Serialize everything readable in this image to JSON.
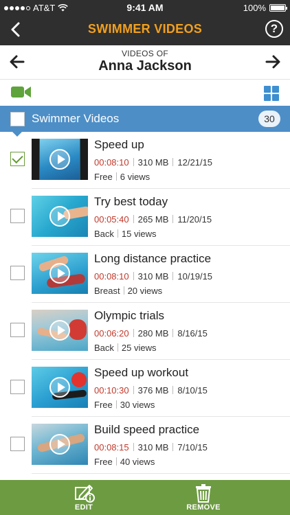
{
  "status": {
    "carrier": "AT&T",
    "time": "9:41 AM",
    "battery": "100%"
  },
  "nav": {
    "title": "SWIMMER VIDEOS",
    "help": "?"
  },
  "owner": {
    "subtitle": "VIDEOS OF",
    "name": "Anna Jackson"
  },
  "section": {
    "label": "Swimmer Videos",
    "count": "30"
  },
  "videos": [
    {
      "title": "Speed up",
      "duration": "00:08:10",
      "size": "310 MB",
      "date": "12/21/15",
      "stroke": "Free",
      "views": "6 views",
      "checked": true
    },
    {
      "title": "Try best today",
      "duration": "00:05:40",
      "size": "265 MB",
      "date": "11/20/15",
      "stroke": "Back",
      "views": "15 views",
      "checked": false
    },
    {
      "title": "Long distance practice",
      "duration": "00:08:10",
      "size": "310 MB",
      "date": "10/19/15",
      "stroke": "Breast",
      "views": "20 views",
      "checked": false
    },
    {
      "title": "Olympic trials",
      "duration": "00:06:20",
      "size": "280 MB",
      "date": "8/16/15",
      "stroke": "Back",
      "views": "25 views",
      "checked": false
    },
    {
      "title": "Speed up workout",
      "duration": "00:10:30",
      "size": "376 MB",
      "date": "8/10/15",
      "stroke": "Free",
      "views": "30 views",
      "checked": false
    },
    {
      "title": "Build speed practice",
      "duration": "00:08:15",
      "size": "310 MB",
      "date": "7/10/15",
      "stroke": "Free",
      "views": "40 views",
      "checked": false
    }
  ],
  "bottom": {
    "edit_label": "EDIT",
    "remove_label": "REMOVE"
  },
  "colors": {
    "accent_title": "#f2a01e",
    "section_blue": "#4d8ec7",
    "bottom_green": "#6d9b42",
    "duration_red": "#c0392b"
  }
}
